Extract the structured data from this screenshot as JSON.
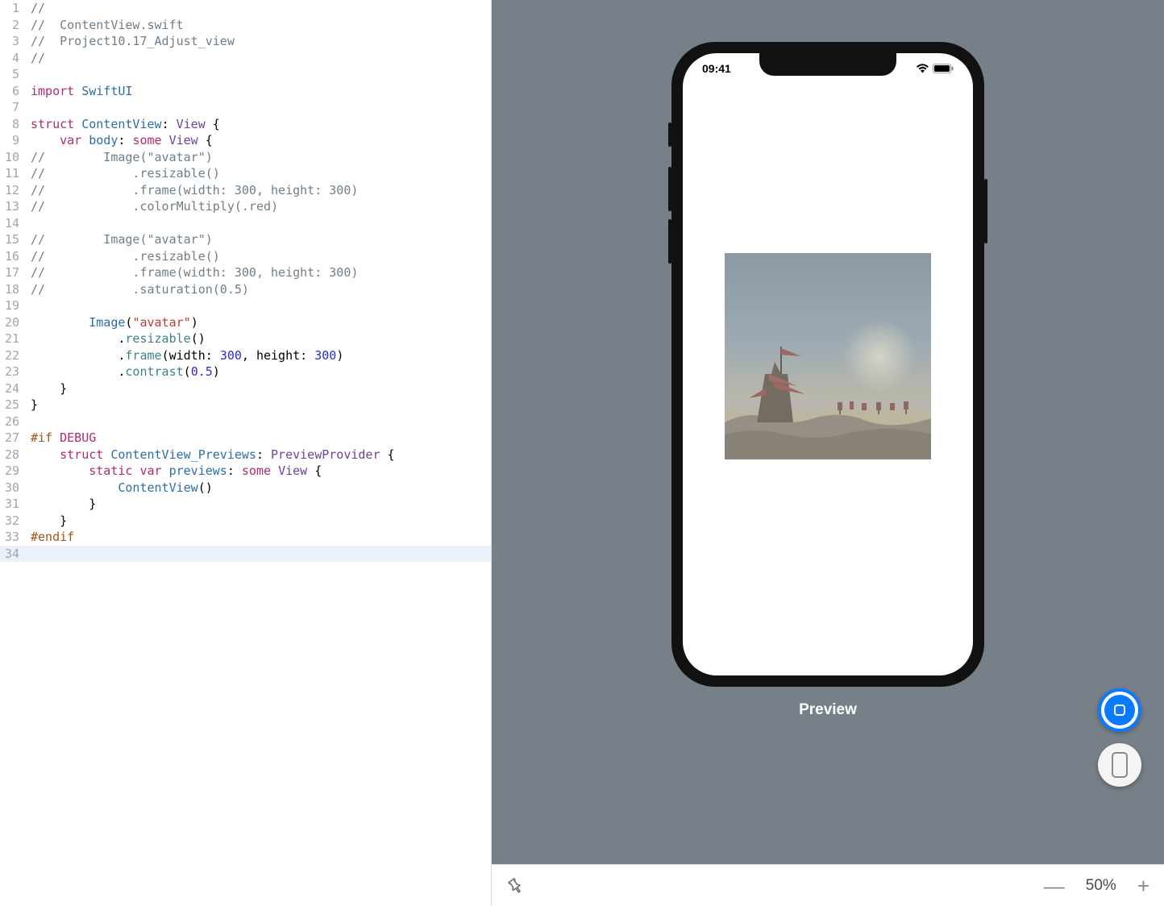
{
  "editor": {
    "lines": [
      {
        "n": 1,
        "tokens": [
          [
            "c-comment",
            "//"
          ]
        ]
      },
      {
        "n": 2,
        "tokens": [
          [
            "c-comment",
            "//  ContentView.swift"
          ]
        ]
      },
      {
        "n": 3,
        "tokens": [
          [
            "c-comment",
            "//  Project10.17_Adjust_view"
          ]
        ]
      },
      {
        "n": 4,
        "tokens": [
          [
            "c-comment",
            "//"
          ]
        ]
      },
      {
        "n": 5,
        "tokens": []
      },
      {
        "n": 6,
        "tokens": [
          [
            "c-keyword",
            "import"
          ],
          [
            "",
            " "
          ],
          [
            "c-type",
            "SwiftUI"
          ]
        ]
      },
      {
        "n": 7,
        "tokens": []
      },
      {
        "n": 8,
        "tokens": [
          [
            "c-keyword",
            "struct"
          ],
          [
            "",
            " "
          ],
          [
            "c-type",
            "ContentView"
          ],
          [
            "",
            ": "
          ],
          [
            "c-typep",
            "View"
          ],
          [
            "",
            " {"
          ]
        ]
      },
      {
        "n": 9,
        "tokens": [
          [
            "",
            "    "
          ],
          [
            "c-keyword",
            "var"
          ],
          [
            "",
            " "
          ],
          [
            "c-type",
            "body"
          ],
          [
            "",
            ": "
          ],
          [
            "c-keyword",
            "some"
          ],
          [
            "",
            " "
          ],
          [
            "c-typep",
            "View"
          ],
          [
            "",
            " {"
          ]
        ]
      },
      {
        "n": 10,
        "tokens": [
          [
            "c-comment",
            "//        Image(\"avatar\")"
          ]
        ]
      },
      {
        "n": 11,
        "tokens": [
          [
            "c-comment",
            "//            .resizable()"
          ]
        ]
      },
      {
        "n": 12,
        "tokens": [
          [
            "c-comment",
            "//            .frame(width: 300, height: 300)"
          ]
        ]
      },
      {
        "n": 13,
        "tokens": [
          [
            "c-comment",
            "//            .colorMultiply(.red)"
          ]
        ]
      },
      {
        "n": 14,
        "tokens": []
      },
      {
        "n": 15,
        "tokens": [
          [
            "c-comment",
            "//        Image(\"avatar\")"
          ]
        ]
      },
      {
        "n": 16,
        "tokens": [
          [
            "c-comment",
            "//            .resizable()"
          ]
        ]
      },
      {
        "n": 17,
        "tokens": [
          [
            "c-comment",
            "//            .frame(width: 300, height: 300)"
          ]
        ]
      },
      {
        "n": 18,
        "tokens": [
          [
            "c-comment",
            "//            .saturation(0.5)"
          ]
        ]
      },
      {
        "n": 19,
        "tokens": []
      },
      {
        "n": 20,
        "tokens": [
          [
            "",
            "        "
          ],
          [
            "c-type",
            "Image"
          ],
          [
            "",
            "("
          ],
          [
            "c-string",
            "\"avatar\""
          ],
          [
            "",
            ")"
          ]
        ]
      },
      {
        "n": 21,
        "tokens": [
          [
            "",
            "            ."
          ],
          [
            "c-func",
            "resizable"
          ],
          [
            "",
            "()"
          ]
        ]
      },
      {
        "n": 22,
        "tokens": [
          [
            "",
            "            ."
          ],
          [
            "c-func",
            "frame"
          ],
          [
            "",
            "(width: "
          ],
          [
            "c-number",
            "300"
          ],
          [
            "",
            ", height: "
          ],
          [
            "c-number",
            "300"
          ],
          [
            "",
            ")"
          ]
        ]
      },
      {
        "n": 23,
        "tokens": [
          [
            "",
            "            ."
          ],
          [
            "c-func",
            "contrast"
          ],
          [
            "",
            "("
          ],
          [
            "c-number",
            "0.5"
          ],
          [
            "",
            ")"
          ]
        ]
      },
      {
        "n": 24,
        "tokens": [
          [
            "",
            "    }"
          ]
        ]
      },
      {
        "n": 25,
        "tokens": [
          [
            "",
            "}"
          ]
        ]
      },
      {
        "n": 26,
        "tokens": []
      },
      {
        "n": 27,
        "tokens": [
          [
            "c-dir",
            "#if"
          ],
          [
            "",
            " "
          ],
          [
            "c-keyword",
            "DEBUG"
          ]
        ]
      },
      {
        "n": 28,
        "tokens": [
          [
            "",
            "    "
          ],
          [
            "c-keyword",
            "struct"
          ],
          [
            "",
            " "
          ],
          [
            "c-type",
            "ContentView_Previews"
          ],
          [
            "",
            ": "
          ],
          [
            "c-typep",
            "PreviewProvider"
          ],
          [
            "",
            " {"
          ]
        ]
      },
      {
        "n": 29,
        "tokens": [
          [
            "",
            "        "
          ],
          [
            "c-keyword",
            "static"
          ],
          [
            "",
            " "
          ],
          [
            "c-keyword",
            "var"
          ],
          [
            "",
            " "
          ],
          [
            "c-type",
            "previews"
          ],
          [
            "",
            ": "
          ],
          [
            "c-keyword",
            "some"
          ],
          [
            "",
            " "
          ],
          [
            "c-typep",
            "View"
          ],
          [
            "",
            " {"
          ]
        ]
      },
      {
        "n": 30,
        "tokens": [
          [
            "",
            "            "
          ],
          [
            "c-type",
            "ContentView"
          ],
          [
            "",
            "()"
          ]
        ]
      },
      {
        "n": 31,
        "tokens": [
          [
            "",
            "        }"
          ]
        ]
      },
      {
        "n": 32,
        "tokens": [
          [
            "",
            "    }"
          ]
        ]
      },
      {
        "n": 33,
        "tokens": [
          [
            "c-dir",
            "#endif"
          ]
        ]
      },
      {
        "n": 34,
        "tokens": [],
        "highlight": true
      }
    ]
  },
  "preview": {
    "status_time": "09:41",
    "label": "Preview",
    "image_name": "avatar"
  },
  "toolbar": {
    "zoom_label": "50%"
  }
}
